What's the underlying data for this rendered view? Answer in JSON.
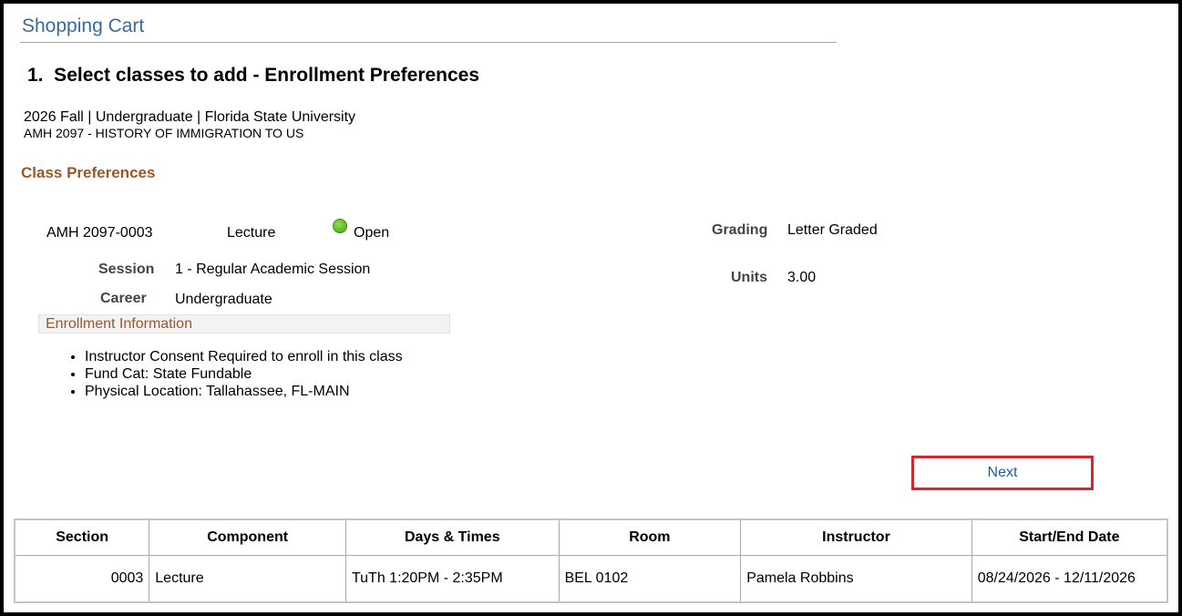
{
  "page_title": "Shopping Cart",
  "step_title": "1.  Select classes to add - Enrollment Preferences",
  "term_line": "2026 Fall | Undergraduate | Florida State University",
  "course_line": "AMH 2097 - HISTORY OF IMMIGRATION TO US",
  "class_preferences_heading": "Class Preferences",
  "class": {
    "section_code": "AMH 2097-0003",
    "component": "Lecture",
    "status": "Open",
    "status_color": "#5cb82a",
    "session_label": "Session",
    "session_value": "1 - Regular Academic Session",
    "career_label": "Career",
    "career_value": "Undergraduate",
    "grading_label": "Grading",
    "grading_value": "Letter Graded",
    "units_label": "Units",
    "units_value": "3.00"
  },
  "enrollment_info": {
    "heading": "Enrollment Information",
    "items": [
      "Instructor Consent Required to enroll in this class",
      "Fund Cat: State Fundable",
      "Physical Location: Tallahassee, FL-MAIN"
    ]
  },
  "next_button": {
    "label": "Next",
    "highlight_color": "#d8242b"
  },
  "section_table": {
    "headers": [
      "Section",
      "Component",
      "Days & Times",
      "Room",
      "Instructor",
      "Start/End Date"
    ],
    "rows": [
      [
        "0003",
        "Lecture",
        "TuTh 1:20PM - 2:35PM",
        "BEL 0102",
        "Pamela Robbins",
        "08/24/2026 - 12/11/2026"
      ]
    ]
  }
}
